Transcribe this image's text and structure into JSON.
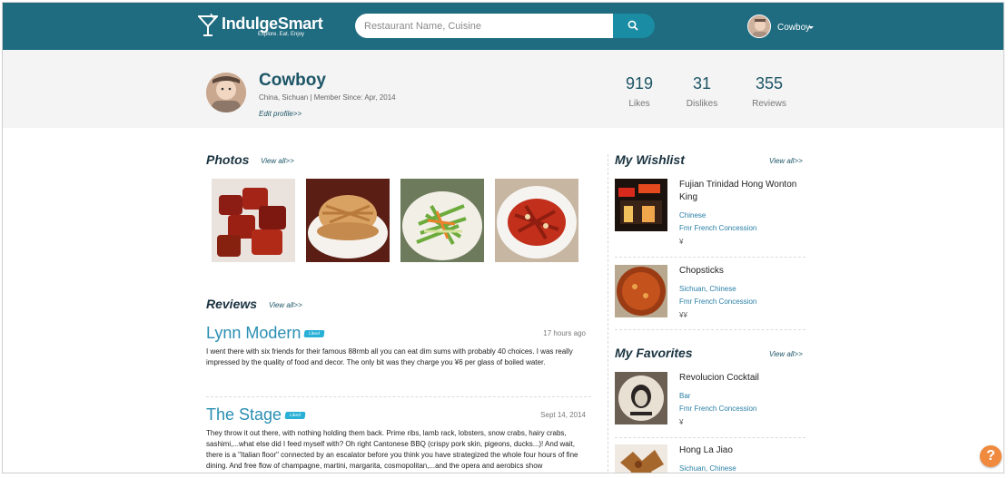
{
  "brand": {
    "name": "IndulgeSmart",
    "tagline": "Explore. Eat. Enjoy"
  },
  "search": {
    "placeholder": "Restaurant Name, Cuisine"
  },
  "user_menu": {
    "name": "Cowboy"
  },
  "profile": {
    "name": "Cowboy",
    "meta": "China, Sichuan | Member Since: Apr, 2014",
    "edit_link": "Edit profile>>",
    "stats": [
      {
        "value": "919",
        "label": "Likes"
      },
      {
        "value": "31",
        "label": "Dislikes"
      },
      {
        "value": "355",
        "label": "Reviews"
      }
    ]
  },
  "photos": {
    "title": "Photos",
    "view_all": "View all>>"
  },
  "reviews": {
    "title": "Reviews",
    "view_all": "View all>>",
    "items": [
      {
        "restaurant": "Lynn Modern",
        "badge": "Liked",
        "time": "17 hours ago",
        "text": "I went there with six friends for their famous 88rmb all you can eat dim sums with probably 40 choices. I was really impressed by the quality of food and decor. The only bit was they charge you ¥6 per glass of boiled water."
      },
      {
        "restaurant": "The Stage",
        "badge": "Liked",
        "time": "Sept 14, 2014",
        "text": "They throw it out there, with nothing holding them back. Prime ribs, lamb rack, lobsters, snow crabs, hairy crabs, sashimi,...what else did I feed myself with? Oh right Cantonese BBQ (crispy pork skin, pigeons, ducks...)! And wait, there is a \"Italian floor\" connected by an escalator before you think you have strategized the whole four hours of fine dining. And free flow of champagne, martini, margarita, cosmopolitan,...and the opera and aerobics show"
      }
    ]
  },
  "wishlist": {
    "title": "My Wishlist",
    "view_all": "View all>>",
    "items": [
      {
        "name": "Fujian Trinidad Hong Wonton King",
        "cuisine": "Chinese",
        "area": "Fmr French Concession",
        "price": "¥"
      },
      {
        "name": "Chopsticks",
        "cuisine": "Sichuan, Chinese",
        "area": "Fmr French Concession",
        "price": "¥¥"
      }
    ]
  },
  "favorites": {
    "title": "My Favorites",
    "view_all": "View all>>",
    "items": [
      {
        "name": "Revolucion Cocktail",
        "cuisine": "Bar",
        "area": "Fmr French Concession",
        "price": "¥"
      },
      {
        "name": "Hong La Jiao",
        "cuisine": "Sichuan, Chinese"
      }
    ]
  },
  "help": {
    "label": "?"
  },
  "colors": {
    "topbar": "#1f6b80",
    "accent": "#2a8fb3",
    "liked_badge": "#29b0d6",
    "help": "#f08a3e"
  }
}
